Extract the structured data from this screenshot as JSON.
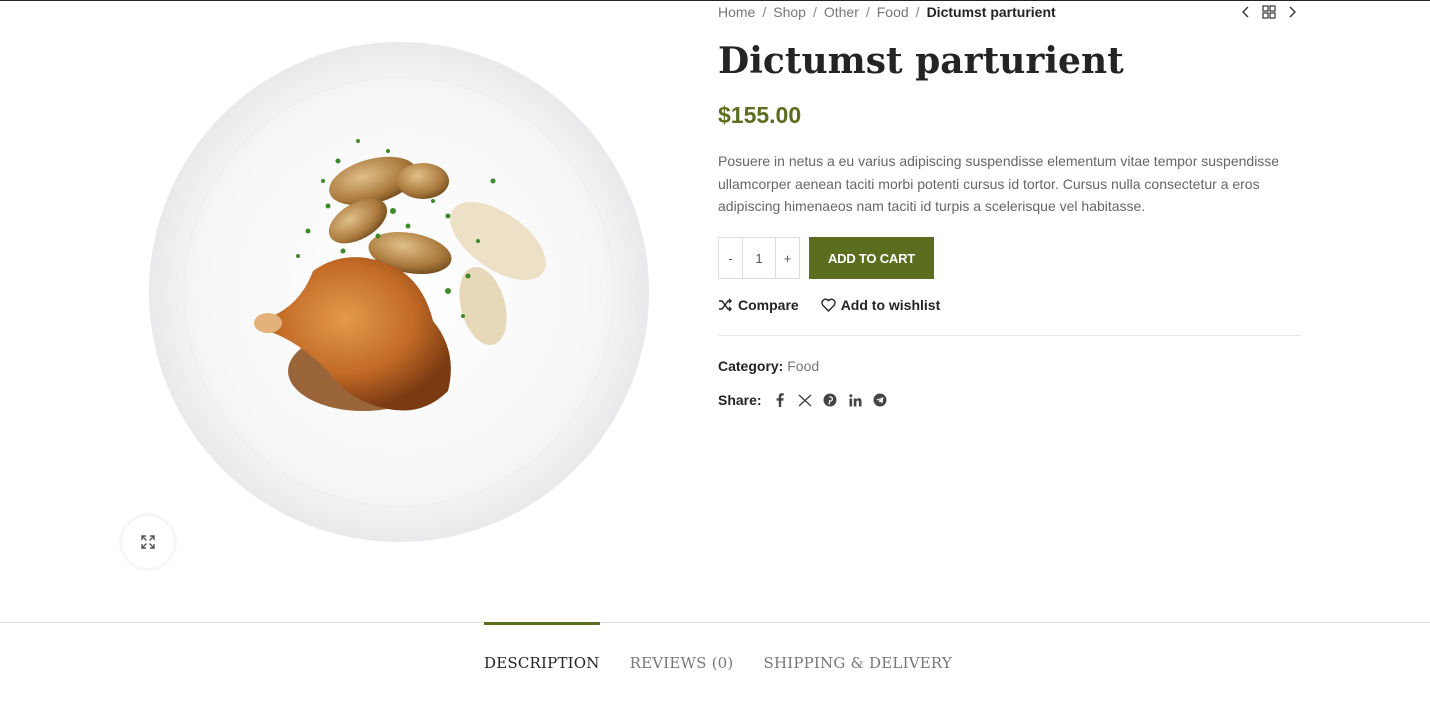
{
  "breadcrumb": {
    "items": [
      "Home",
      "Shop",
      "Other",
      "Food"
    ],
    "separator": "/",
    "current": "Dictumst parturient"
  },
  "product": {
    "title": "Dictumst parturient",
    "price": "$155.00",
    "description": "Posuere in netus a eu varius adipiscing suspendisse elementum vitae tempor suspendisse ullamcorper aenean taciti morbi potenti cursus id tortor. Cursus nulla consectetur a eros adipiscing himenaeos nam taciti id turpis a scelerisque vel habitasse.",
    "quantity": {
      "minus": "-",
      "value": "1",
      "plus": "+"
    },
    "add_to_cart": "ADD TO CART",
    "compare": "Compare",
    "wishlist": "Add to wishlist",
    "category_label": "Category:",
    "category_value": "Food",
    "share_label": "Share:",
    "share_icons": [
      "facebook-icon",
      "x-twitter-icon",
      "pinterest-icon",
      "linkedin-icon",
      "telegram-icon"
    ]
  },
  "tabs": [
    {
      "label": "DESCRIPTION",
      "active": true
    },
    {
      "label": "REVIEWS (0)",
      "active": false
    },
    {
      "label": "SHIPPING & DELIVERY",
      "active": false
    }
  ],
  "colors": {
    "accent": "#5b6e1f",
    "text": "#242424",
    "muted": "#777777"
  }
}
